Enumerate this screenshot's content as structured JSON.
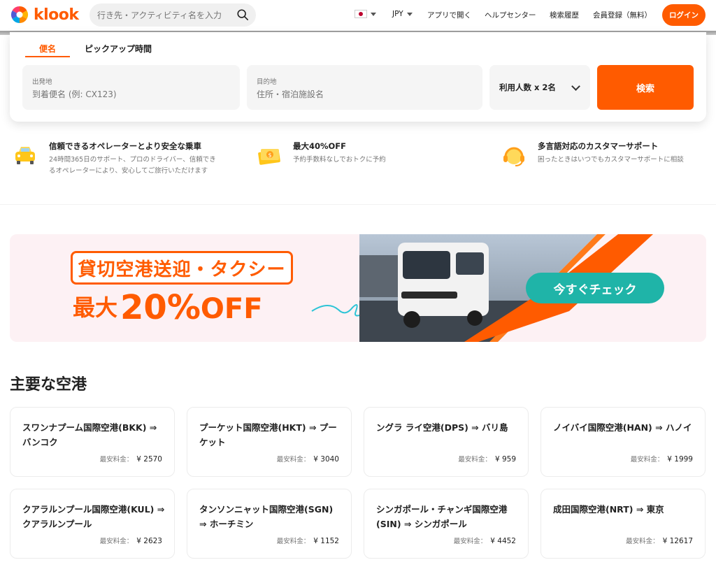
{
  "brand": {
    "name": "klook",
    "color": "#ff5b00"
  },
  "header": {
    "search_placeholder": "行き先・アクティビティ名を入力",
    "currency": "JPY",
    "language_flag": "japan-flag-icon",
    "nav": [
      "アプリで開く",
      "ヘルプセンター",
      "検索履歴",
      "会員登録（無料）"
    ],
    "login": "ログイン"
  },
  "booking": {
    "tabs": [
      "便名",
      "ピックアップ時間"
    ],
    "active_tab": "便名",
    "origin": {
      "label": "出発地",
      "placeholder": "到着便名 (例: CX123)"
    },
    "destination": {
      "label": "目的地",
      "placeholder": "住所・宿泊施設名"
    },
    "passengers": "利用人数 x 2名",
    "search_button": "検索"
  },
  "features": [
    {
      "icon": "car-icon",
      "title": "信頼できるオペレーターとより安全な乗車",
      "desc": "24時間365日のサポート、プロのドライバー、信頼できるオペレーターにより、安心してご旅行いただけます"
    },
    {
      "icon": "discount-ticket-icon",
      "title": "最大40%OFF",
      "desc": "予約手数料なしでおトクに予約"
    },
    {
      "icon": "headset-icon",
      "title": "多言語対応のカスタマーサポート",
      "desc": "困ったときはいつでもカスタマーサポートに相談"
    }
  ],
  "banner": {
    "headline": "貸切空港送迎・タクシー",
    "prefix": "最大",
    "discount": "20%",
    "off": "OFF",
    "cta": "今すぐチェック",
    "colors": {
      "accent": "#ff5b00",
      "cta": "#1fb4a8",
      "background": "#fdf1f4"
    }
  },
  "airports": {
    "title": "主要な空港",
    "price_label": "最安料金：",
    "items": [
      {
        "name": "スワンナプーム国際空港(BKK) ⇒ バンコク",
        "price": "¥ 2570"
      },
      {
        "name": "プーケット国際空港(HKT) ⇒ プーケット",
        "price": "¥ 3040"
      },
      {
        "name": "ングラ ライ空港(DPS) ⇒ バリ島",
        "price": "¥ 959"
      },
      {
        "name": "ノイバイ国際空港(HAN) ⇒ ハノイ",
        "price": "¥ 1999"
      },
      {
        "name": "クアラルンプール国際空港(KUL) ⇒ クアラルンプール",
        "price": "¥ 2623"
      },
      {
        "name": "タンソンニャット国際空港(SGN) ⇒ ホーチミン",
        "price": "¥ 1152"
      },
      {
        "name": "シンガポール・チャンギ国際空港(SIN) ⇒ シンガポール",
        "price": "¥ 4452"
      },
      {
        "name": "成田国際空港(NRT) ⇒ 東京",
        "price": "¥ 12617"
      }
    ]
  }
}
